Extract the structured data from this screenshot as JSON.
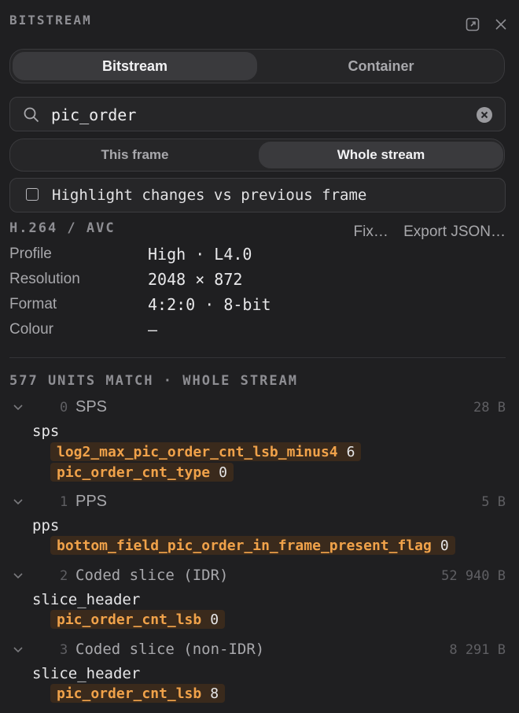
{
  "panel": {
    "title": "BITSTREAM"
  },
  "tabs": {
    "bitstream": "Bitstream",
    "container": "Container"
  },
  "search": {
    "value": "pic_order"
  },
  "scope": {
    "this_frame": "This frame",
    "whole_stream": "Whole stream"
  },
  "highlight": {
    "label": "Highlight changes vs previous frame",
    "checked": false
  },
  "codec": {
    "title": "H.264 / AVC",
    "fix_label": "Fix…",
    "export_label": "Export JSON…",
    "props": [
      {
        "key": "Profile",
        "value": "High · L4.0"
      },
      {
        "key": "Resolution",
        "value": "2048 × 872"
      },
      {
        "key": "Format",
        "value": "4:2:0 · 8-bit"
      },
      {
        "key": "Colour",
        "value": "—"
      }
    ]
  },
  "matches": {
    "title": "577 UNITS MATCH · WHOLE STREAM",
    "units": [
      {
        "index": "0",
        "name": "SPS",
        "size": "28 B",
        "group": "sps",
        "fields": [
          {
            "name": "log2_max_pic_order_cnt_lsb_minus4",
            "value": "6"
          },
          {
            "name": "pic_order_cnt_type",
            "value": "0"
          }
        ]
      },
      {
        "index": "1",
        "name": "PPS",
        "size": "5 B",
        "group": "pps",
        "fields": [
          {
            "name": "bottom_field_pic_order_in_frame_present_flag",
            "value": "0"
          }
        ]
      },
      {
        "index": "2",
        "name": "Coded slice (IDR)",
        "size": "52 940 B",
        "group": "slice_header",
        "fields": [
          {
            "name": "pic_order_cnt_lsb",
            "value": "0"
          }
        ]
      },
      {
        "index": "3",
        "name": "Coded slice (non-IDR)",
        "size": "8 291 B",
        "group": "slice_header",
        "fields": [
          {
            "name": "pic_order_cnt_lsb",
            "value": "8"
          }
        ]
      }
    ]
  },
  "icons": {
    "popout": "popout-icon",
    "close": "close-icon",
    "search": "search-icon",
    "clear": "clear-icon",
    "chevron": "chevron-down-icon"
  }
}
